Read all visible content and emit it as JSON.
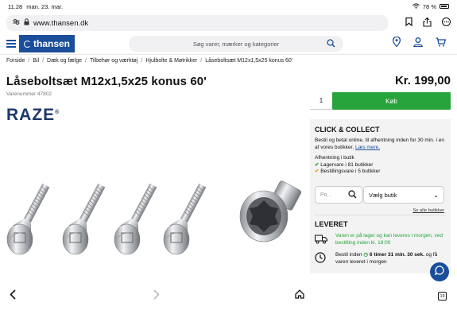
{
  "status_bar": {
    "time": "11.28",
    "date": "man. 23. mar.",
    "battery": "78 %"
  },
  "browser": {
    "url": "www.thansen.dk",
    "tab_count": "19"
  },
  "header": {
    "logo": "thansen",
    "search_placeholder": "Søg varer, mærker og kategorier"
  },
  "breadcrumb": [
    "Forside",
    "Bil",
    "Dæk og fælge",
    "Tilbehør og værktøj",
    "Hjulbolte & Møtrikker",
    "Låseboltsæt M12x1,5x25 konus 60'"
  ],
  "product": {
    "title": "Låseboltsæt M12x1,5x25 konus 60'",
    "item_number": "Varenummer 47802",
    "price": "Kr. 199,00",
    "brand": "RAZE",
    "brand_mark": "®",
    "quantity": "1",
    "buy_label": "Køb"
  },
  "click_collect": {
    "title": "CLICK & COLLECT",
    "desc": "Bestil og betal online, til afhentning inden for 30 min. i en af vores butikker.",
    "read_more": "Læs mere.",
    "pickup_title": "Afhentning i butik",
    "stock_line": "Lagervare i 81 butikker",
    "order_line": "Bestillingsvare i 5 butikker",
    "postcode_placeholder": "Po...",
    "store_select": "Vælg butik",
    "see_all": "Se alle butikker"
  },
  "delivery": {
    "title": "LEVERET",
    "line1": "Varen er på lager og kan leveres i morgen, ved bestilling inden kl. 18:00",
    "order_prefix": "Bestil inden",
    "countdown": "6 timer 31 min. 30 sek.",
    "order_suffix": "og få varen leveret i morgen"
  }
}
